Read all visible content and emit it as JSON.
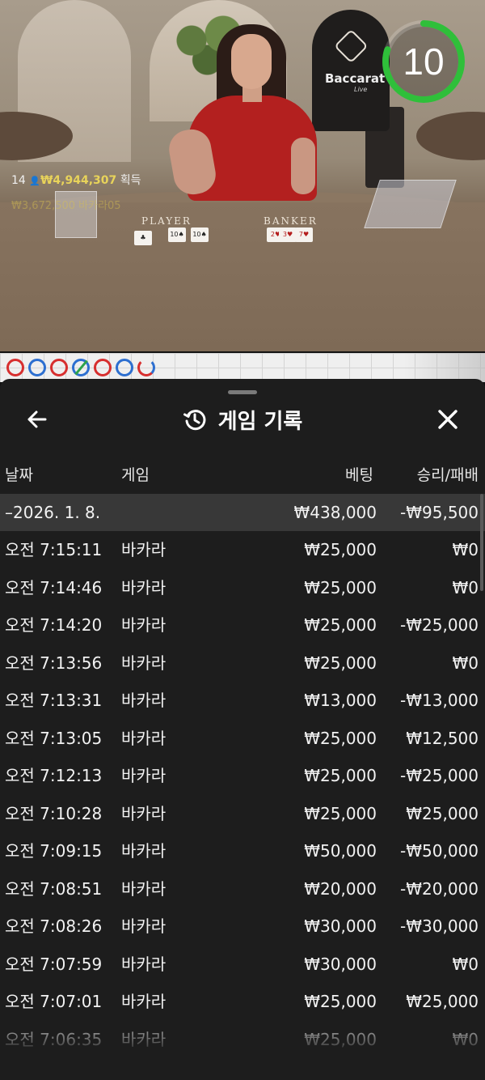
{
  "video": {
    "brand_title": "Baccarat",
    "brand_sub": "Live",
    "timer": "10",
    "timer_fraction": 0.8,
    "winners_count": "14",
    "winners_amount": "₩4,944,307",
    "winners_suffix": "획득",
    "winners_line2": "₩3,672,500 바카라05",
    "table_player": "PLAYER",
    "table_banker": "BANKER",
    "player_cards": [
      "♣",
      "10♠",
      "10♠"
    ],
    "banker_cards": [
      "2♥",
      "3♥",
      "7♥"
    ]
  },
  "roadmap": {
    "beads": [
      "red",
      "blue",
      "red",
      "blue-slash",
      "red",
      "blue",
      "red-partial"
    ]
  },
  "sheet": {
    "title": "게임 기록",
    "columns": {
      "date": "날짜",
      "game": "게임",
      "bet": "베팅",
      "result": "승리/패배"
    },
    "summary": {
      "date": "–2026. 1. 8.",
      "bet": "₩438,000",
      "result": "-₩95,500"
    },
    "rows": [
      {
        "time": "오전 7:15:11",
        "game": "바카라",
        "bet": "₩25,000",
        "result": "₩0"
      },
      {
        "time": "오전 7:14:46",
        "game": "바카라",
        "bet": "₩25,000",
        "result": "₩0"
      },
      {
        "time": "오전 7:14:20",
        "game": "바카라",
        "bet": "₩25,000",
        "result": "-₩25,000"
      },
      {
        "time": "오전 7:13:56",
        "game": "바카라",
        "bet": "₩25,000",
        "result": "₩0"
      },
      {
        "time": "오전 7:13:31",
        "game": "바카라",
        "bet": "₩13,000",
        "result": "-₩13,000"
      },
      {
        "time": "오전 7:13:05",
        "game": "바카라",
        "bet": "₩25,000",
        "result": "₩12,500"
      },
      {
        "time": "오전 7:12:13",
        "game": "바카라",
        "bet": "₩25,000",
        "result": "-₩25,000"
      },
      {
        "time": "오전 7:10:28",
        "game": "바카라",
        "bet": "₩25,000",
        "result": "₩25,000"
      },
      {
        "time": "오전 7:09:15",
        "game": "바카라",
        "bet": "₩50,000",
        "result": "-₩50,000"
      },
      {
        "time": "오전 7:08:51",
        "game": "바카라",
        "bet": "₩20,000",
        "result": "-₩20,000"
      },
      {
        "time": "오전 7:08:26",
        "game": "바카라",
        "bet": "₩30,000",
        "result": "-₩30,000"
      },
      {
        "time": "오전 7:07:59",
        "game": "바카라",
        "bet": "₩30,000",
        "result": "₩0"
      },
      {
        "time": "오전 7:07:01",
        "game": "바카라",
        "bet": "₩25,000",
        "result": "₩25,000"
      },
      {
        "time": "오전 7:06:35",
        "game": "바카라",
        "bet": "₩25,000",
        "result": "₩0"
      }
    ]
  },
  "colors": {
    "sheet_bg": "#1d1d1d",
    "summary_bg": "#383838",
    "timer_ring": "#2fbf3a",
    "win_gold": "#e8d35a"
  }
}
